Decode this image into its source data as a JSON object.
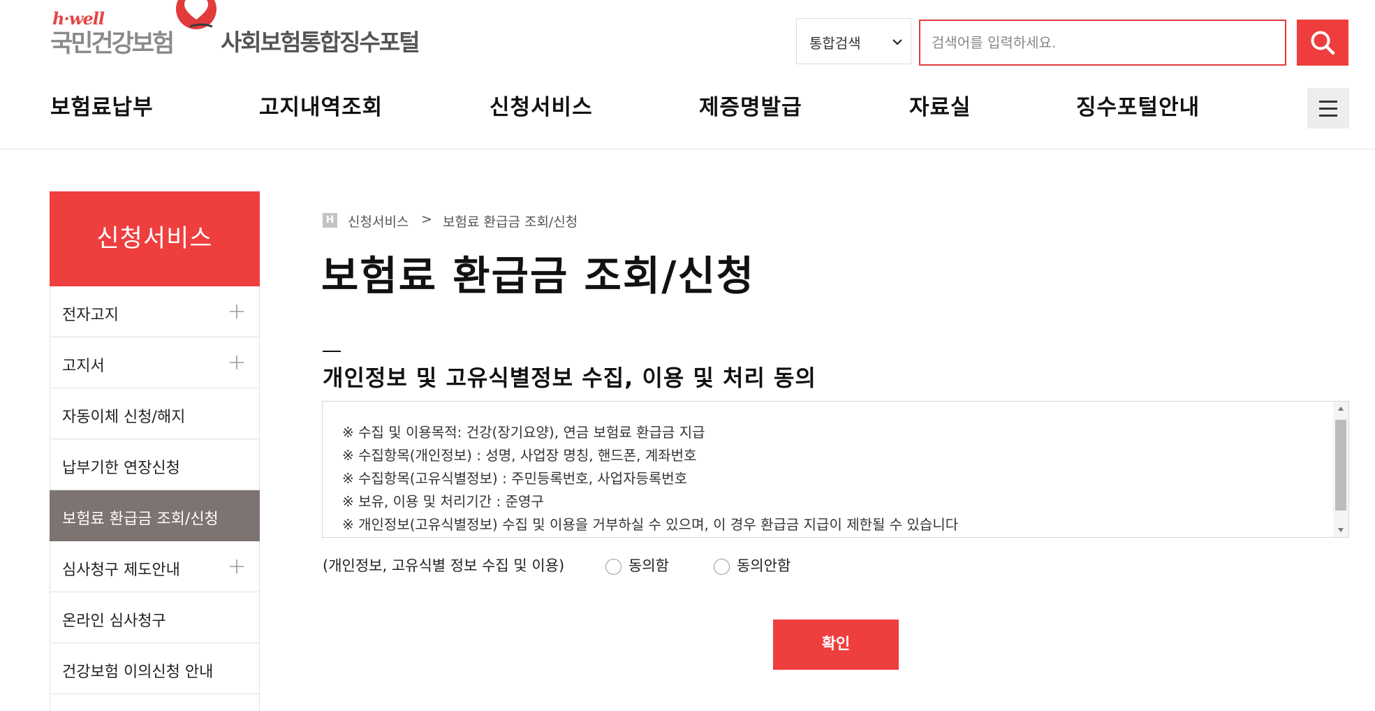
{
  "logo": {
    "hwell": "h·well",
    "nhis": "국민건강보험",
    "portal": "사회보험통합징수포털"
  },
  "search": {
    "scope": "통합검색",
    "placeholder": "검색어를 입력하세요."
  },
  "gnb": [
    "보험료납부",
    "고지내역조회",
    "신청서비스",
    "제증명발급",
    "자료실",
    "징수포털안내"
  ],
  "sidebar": {
    "title": "신청서비스",
    "items": [
      {
        "label": "전자고지",
        "expandable": true,
        "active": false
      },
      {
        "label": "고지서",
        "expandable": true,
        "active": false
      },
      {
        "label": "자동이체 신청/해지",
        "expandable": false,
        "active": false
      },
      {
        "label": "납부기한 연장신청",
        "expandable": false,
        "active": false
      },
      {
        "label": "보험료 환급금 조회/신청",
        "expandable": false,
        "active": true
      },
      {
        "label": "심사청구 제도안내",
        "expandable": true,
        "active": false
      },
      {
        "label": "온라인 심사청구",
        "expandable": false,
        "active": false
      },
      {
        "label": "건강보험 이의신청 안내",
        "expandable": false,
        "active": false
      }
    ]
  },
  "breadcrumb": {
    "home_badge": "H",
    "level1": "신청서비스",
    "separator": ">",
    "level2": "보험료 환급금 조회/신청"
  },
  "page_title": "보험료 환급금 조회/신청",
  "consent": {
    "section_title": "개인정보 및 고유식별정보 수집, 이용 및 처리 동의",
    "lines": [
      "※ 수집 및 이용목적: 건강(장기요양), 연금 보험료 환급금 지급",
      "※ 수집항목(개인정보) : 성명, 사업장 명칭, 핸드폰, 계좌번호",
      "※ 수집항목(고유식별정보) : 주민등록번호, 사업자등록번호",
      "※ 보유, 이용 및 처리기간 : 준영구",
      "※ 개인정보(고유식별정보) 수집 및 이용을 거부하실 수 있으며, 이 경우 환급금 지급이 제한될 수 있습니다"
    ],
    "agree_label": "(개인정보, 고유식별 정보 수집 및 이용)",
    "option_agree": "동의함",
    "option_disagree": "동의안함"
  },
  "confirm_label": "확인",
  "colors": {
    "brand_red": "#ef3e3e",
    "active_menu": "#7d7370"
  }
}
